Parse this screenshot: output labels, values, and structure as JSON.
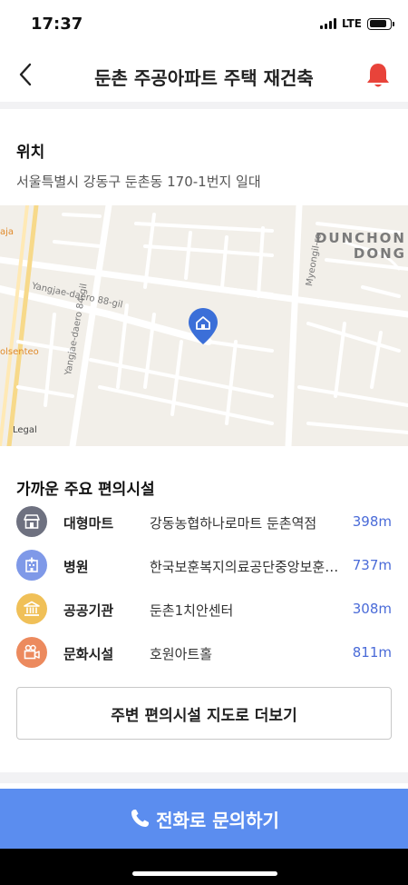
{
  "status_bar": {
    "time": "17:37",
    "network": "LTE",
    "battery_level": 0.85
  },
  "nav": {
    "title": "둔촌 주공아파트 주택 재건축",
    "bell_color": "#e8433a"
  },
  "location": {
    "title": "위치",
    "address": "서울특별시 강동구 둔촌동 170-1번지 일대"
  },
  "map": {
    "district_line1": "DUNCHON",
    "district_line2": "DONG",
    "street1": "Yangjae-daero 88-gil",
    "street2": "Yangjae-daero 84-gil",
    "street3": "Myeongil-ro",
    "place1": "aja",
    "place2": "olsenteo",
    "legal": "Legal",
    "marker_icon": "home-icon",
    "marker_color": "#3b6fd8"
  },
  "facilities": {
    "title": "가까운 주요 편의시설",
    "items": [
      {
        "category": "대형마트",
        "name": "강동농협하나로마트 둔촌역점",
        "distance": "398m",
        "icon": "store-icon",
        "color": "#6e7180"
      },
      {
        "category": "병원",
        "name": "한국보훈복지의료공단중앙보훈병원",
        "distance": "737m",
        "icon": "hospital-icon",
        "color": "#7f99e8"
      },
      {
        "category": "공공기관",
        "name": "둔촌1치안센터",
        "distance": "308m",
        "icon": "government-icon",
        "color": "#f0c058"
      },
      {
        "category": "문화시설",
        "name": "호원아트홀",
        "distance": "811m",
        "icon": "camera-icon",
        "color": "#ec8a5e"
      }
    ]
  },
  "more_button": "주변 편의시설 지도로 더보기",
  "call_button": "전화로 문의하기",
  "accent_color": "#5b8def"
}
